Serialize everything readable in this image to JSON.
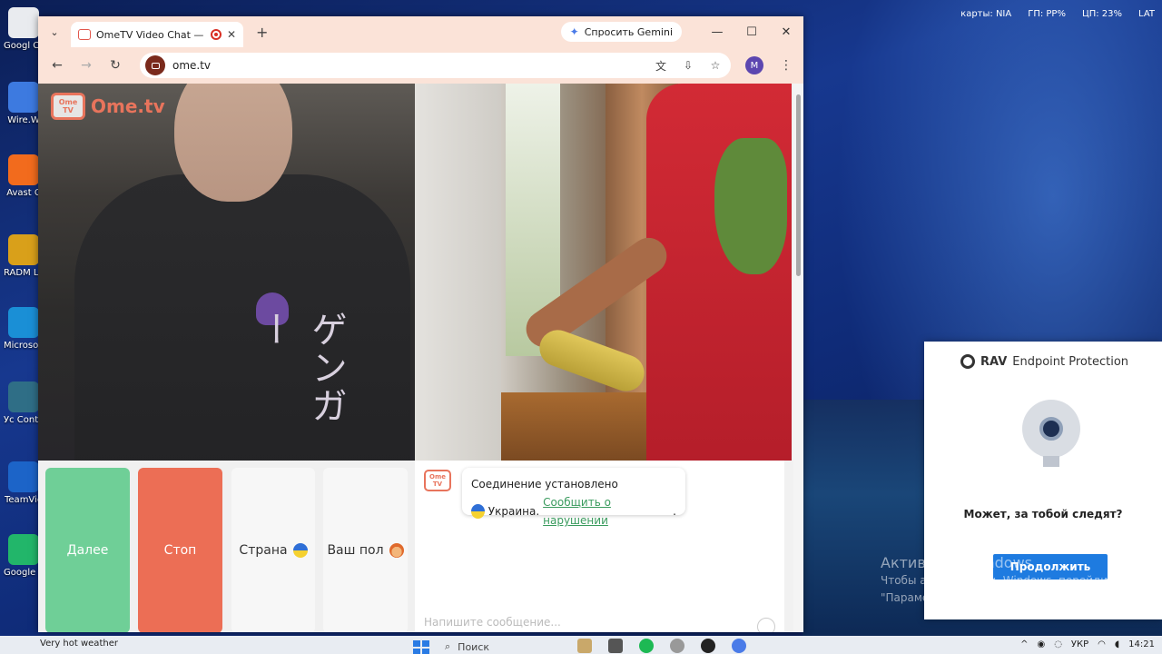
{
  "desktop": {
    "icons": [
      {
        "label": "Googl Chrom",
        "name": "google-chrome",
        "color": "#e9ebef"
      },
      {
        "label": "Wire.W",
        "name": "wire",
        "color": "#3d7ae0"
      },
      {
        "label": "Avast C",
        "name": "avast",
        "color": "#f26b1d"
      },
      {
        "label": "RADM Launch",
        "name": "radmin",
        "color": "#d9a01a"
      },
      {
        "label": "Microso Edge",
        "name": "edge",
        "color": "#1a8fd6"
      },
      {
        "label": "Ус Contro этоCente",
        "name": "control-center",
        "color": "#2f6e86"
      },
      {
        "label": "TeamVie",
        "name": "teamviewer",
        "color": "#1c64c8"
      },
      {
        "label": "Google Игрух",
        "name": "google-games",
        "color": "#22b66a"
      }
    ],
    "tray_top": [
      "карты: NIA",
      "ГП: РР%",
      "ЦП: 23%",
      "LAT"
    ]
  },
  "browser": {
    "tab_title": "OmeTV Video Chat — Ome",
    "new_tab": "+",
    "gemini_label": "Спросить Gemini",
    "url": "ome.tv",
    "profile_initial": "M",
    "window_controls": {
      "minimize": "—",
      "maximize": "☐",
      "close": "✕"
    }
  },
  "page": {
    "logo_tv": "Ome TV",
    "logo_word": "Ome.tv",
    "left_shirt_text": "ゲンガー",
    "buttons": {
      "next": "Далее",
      "stop": "Стоп",
      "country": "Страна",
      "gender": "Ваш пол"
    },
    "chat": {
      "logo_tv": "Ome TV",
      "status": "Соединение установлено",
      "country": "Украина.",
      "report_link": "Сообщить о нарушении",
      "report_suffix": ".",
      "input_placeholder": "Напишите сообщение..."
    }
  },
  "rav": {
    "brand_bold": "RAV",
    "brand_rest": "Endpoint Protection",
    "question": "Может, за тобой следят?",
    "continue": "Продолжить"
  },
  "activation": {
    "title": "Активация Windows",
    "line1": "Чтобы активировать Windows, перейдите в раздел",
    "line2": "\"Параметры\"."
  },
  "taskbar": {
    "weather": "Very hot weather",
    "search": "Поиск",
    "lang": "УКР",
    "time": "14:21"
  },
  "colors": {
    "next": "#6fcf97",
    "stop": "#ec6e55",
    "accent": "#e8745c",
    "rav_button": "#1e7be0"
  }
}
